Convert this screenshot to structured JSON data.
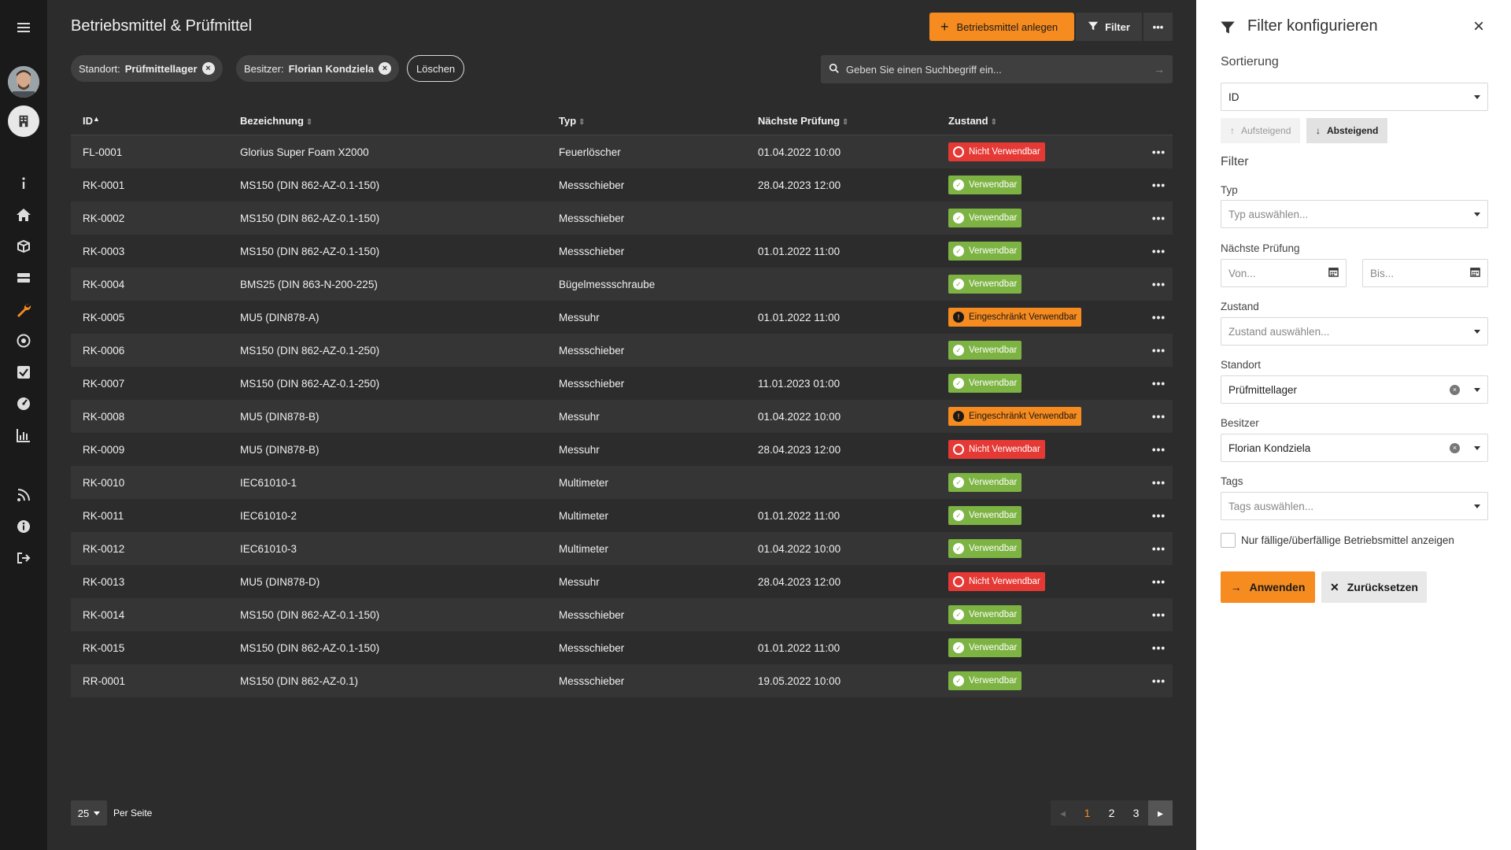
{
  "page": {
    "title": "Betriebsmittel & Prüfmittel",
    "create_label": "Betriebsmittel anlegen",
    "filter_label": "Filter",
    "more_label": "•••"
  },
  "chips": [
    {
      "key": "Standort:",
      "value": "Prüfmittellager"
    },
    {
      "key": "Besitzer:",
      "value": "Florian Kondziela"
    }
  ],
  "clear_label": "Löschen",
  "search": {
    "placeholder": "Geben Sie einen Suchbegriff ein..."
  },
  "table": {
    "headers": [
      "ID",
      "Bezeichnung",
      "Typ",
      "Nächste Prüfung",
      "Zustand"
    ],
    "sort_up": "▲",
    "sort_both": "⇕",
    "action": "•••",
    "rows": [
      {
        "id": "FL-0001",
        "bez": "Glorius Super Foam X2000",
        "typ": "Feuerlöscher",
        "np": "01.04.2022 10:00",
        "zu": "Nicht Verwendbar",
        "status": "red"
      },
      {
        "id": "RK-0001",
        "bez": "MS150 (DIN 862-AZ-0.1-150)",
        "typ": "Messschieber",
        "np": "28.04.2023 12:00",
        "zu": "Verwendbar",
        "status": "green"
      },
      {
        "id": "RK-0002",
        "bez": "MS150 (DIN 862-AZ-0.1-150)",
        "typ": "Messschieber",
        "np": "",
        "zu": "Verwendbar",
        "status": "green"
      },
      {
        "id": "RK-0003",
        "bez": "MS150 (DIN 862-AZ-0.1-150)",
        "typ": "Messschieber",
        "np": "01.01.2022 11:00",
        "zu": "Verwendbar",
        "status": "green"
      },
      {
        "id": "RK-0004",
        "bez": "BMS25 (DIN 863-N-200-225)",
        "typ": "Bügelmessschraube",
        "np": "",
        "zu": "Verwendbar",
        "status": "green"
      },
      {
        "id": "RK-0005",
        "bez": "MU5 (DIN878-A)",
        "typ": "Messuhr",
        "np": "01.01.2022 11:00",
        "zu": "Eingeschränkt Verwendbar",
        "status": "orange"
      },
      {
        "id": "RK-0006",
        "bez": "MS150 (DIN 862-AZ-0.1-250)",
        "typ": "Messschieber",
        "np": "",
        "zu": "Verwendbar",
        "status": "green"
      },
      {
        "id": "RK-0007",
        "bez": "MS150 (DIN 862-AZ-0.1-250)",
        "typ": "Messschieber",
        "np": "11.01.2023 01:00",
        "zu": "Verwendbar",
        "status": "green"
      },
      {
        "id": "RK-0008",
        "bez": "MU5 (DIN878-B)",
        "typ": "Messuhr",
        "np": "01.04.2022 10:00",
        "zu": "Eingeschränkt Verwendbar",
        "status": "orange"
      },
      {
        "id": "RK-0009",
        "bez": "MU5 (DIN878-B)",
        "typ": "Messuhr",
        "np": "28.04.2023 12:00",
        "zu": "Nicht Verwendbar",
        "status": "red"
      },
      {
        "id": "RK-0010",
        "bez": "IEC61010-1",
        "typ": "Multimeter",
        "np": "",
        "zu": "Verwendbar",
        "status": "green"
      },
      {
        "id": "RK-0011",
        "bez": "IEC61010-2",
        "typ": "Multimeter",
        "np": "01.01.2022 11:00",
        "zu": "Verwendbar",
        "status": "green"
      },
      {
        "id": "RK-0012",
        "bez": "IEC61010-3",
        "typ": "Multimeter",
        "np": "01.04.2022 10:00",
        "zu": "Verwendbar",
        "status": "green"
      },
      {
        "id": "RK-0013",
        "bez": "MU5 (DIN878-D)",
        "typ": "Messuhr",
        "np": "28.04.2023 12:00",
        "zu": "Nicht Verwendbar",
        "status": "red"
      },
      {
        "id": "RK-0014",
        "bez": "MS150 (DIN 862-AZ-0.1-150)",
        "typ": "Messschieber",
        "np": "",
        "zu": "Verwendbar",
        "status": "green"
      },
      {
        "id": "RK-0015",
        "bez": "MS150 (DIN 862-AZ-0.1-150)",
        "typ": "Messschieber",
        "np": "01.01.2022 11:00",
        "zu": "Verwendbar",
        "status": "green"
      },
      {
        "id": "RR-0001",
        "bez": "MS150 (DIN 862-AZ-0.1)",
        "typ": "Messschieber",
        "np": "19.05.2022 10:00",
        "zu": "Verwendbar",
        "status": "green"
      }
    ]
  },
  "pagination": {
    "per_page_value": "25",
    "per_page_label": "Per Seite",
    "pages": [
      "1",
      "2",
      "3"
    ],
    "active_page": "1"
  },
  "panel": {
    "title": "Filter konfigurieren",
    "sort_title": "Sortierung",
    "sort_value": "ID",
    "asc_label": "Aufsteigend",
    "desc_label": "Absteigend",
    "filter_title": "Filter",
    "typ_label": "Typ",
    "typ_placeholder": "Typ auswählen...",
    "np_label": "Nächste Prüfung",
    "from_placeholder": "Von...",
    "to_placeholder": "Bis...",
    "zustand_label": "Zustand",
    "zustand_placeholder": "Zustand auswählen...",
    "standort_label": "Standort",
    "standort_value": "Prüfmittellager",
    "besitzer_label": "Besitzer",
    "besitzer_value": "Florian Kondziela",
    "tags_label": "Tags",
    "tags_placeholder": "Tags auswählen...",
    "due_only_label": "Nur fällige/überfällige Betriebsmittel anzeigen",
    "apply_label": "Anwenden",
    "reset_label": "Zurücksetzen"
  },
  "colors": {
    "accent": "#f68b1f",
    "green": "#7cb342",
    "red": "#e53935",
    "sidebar_bg": "#1a1a1a",
    "main_bg": "#2c2c2c"
  },
  "icons": [
    "menu-icon",
    "avatar",
    "building-icon",
    "info-icon",
    "home-icon",
    "boxes-icon",
    "server-icon",
    "wrench-icon",
    "target-icon",
    "checkbox-icon",
    "gauge-icon",
    "chart-icon",
    "feed-icon",
    "info-circle-icon",
    "logout-icon"
  ]
}
